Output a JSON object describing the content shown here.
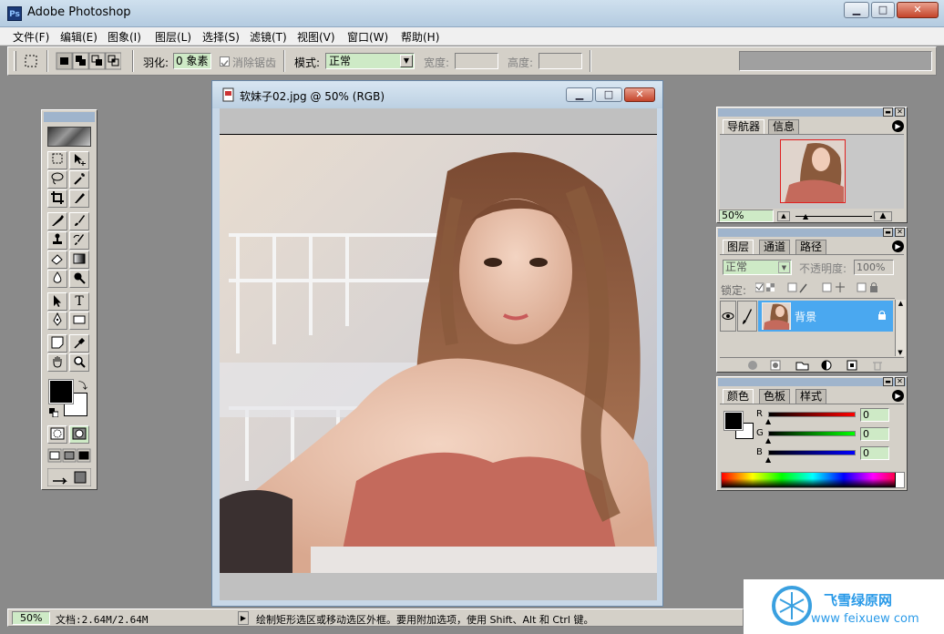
{
  "window": {
    "title": "Adobe Photoshop",
    "app_icon": "Ps"
  },
  "window_controls": {
    "minimize": "▁",
    "maximize": "□",
    "close": "✕"
  },
  "menu": [
    "文件(F)",
    "编辑(E)",
    "图象(I)",
    "图层(L)",
    "选择(S)",
    "滤镜(T)",
    "视图(V)",
    "窗口(W)",
    "帮助(H)"
  ],
  "options": {
    "feather_label": "羽化:",
    "feather_value": "0 象素",
    "antialias_label": "消除锯齿",
    "style_label": "模式:",
    "style_value": "正常",
    "width_label": "宽度:",
    "height_label": "高度:"
  },
  "document": {
    "title": "软妹子02.jpg @ 50% (RGB)"
  },
  "navigator": {
    "tabs": [
      "导航器",
      "信息"
    ],
    "zoom": "50%"
  },
  "layers": {
    "tabs": [
      "图层",
      "通道",
      "路径"
    ],
    "blend_mode": "正常",
    "opacity_label": "不透明度:",
    "opacity_value": "100%",
    "lock_label": "锁定:",
    "layer_name": "背景"
  },
  "color": {
    "tabs": [
      "颜色",
      "色板",
      "样式"
    ],
    "channels": [
      {
        "label": "R",
        "value": "0"
      },
      {
        "label": "G",
        "value": "0"
      },
      {
        "label": "B",
        "value": "0"
      }
    ]
  },
  "status": {
    "zoom": "50%",
    "doc_info": "文档:2.64M/2.64M",
    "hint": "绘制矩形选区或移动选区外框。要用附加选项，使用 Shift、Alt 和 Ctrl 键。"
  },
  "watermark": {
    "cn": "飞雪绿原网",
    "url": "www  feixuew  com"
  },
  "colors": {
    "layer_selected": "#4aa8f0",
    "title_gradient": "#bcd0e2",
    "workspace": "#8a8a8a"
  }
}
